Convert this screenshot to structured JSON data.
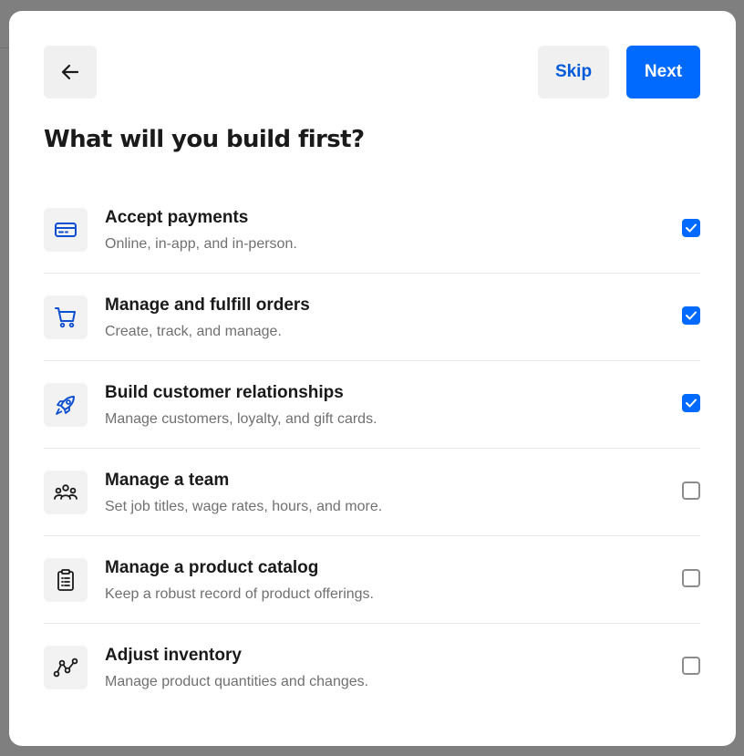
{
  "header": {
    "skip_label": "Skip",
    "next_label": "Next"
  },
  "title": "What will you build first?",
  "options": [
    {
      "icon": "credit-card-icon",
      "title": "Accept payments",
      "subtitle": "Online, in-app, and in-person.",
      "checked": true
    },
    {
      "icon": "shopping-cart-icon",
      "title": "Manage and fulfill orders",
      "subtitle": "Create, track, and manage.",
      "checked": true
    },
    {
      "icon": "rocket-icon",
      "title": "Build customer relationships",
      "subtitle": "Manage customers, loyalty, and gift cards.",
      "checked": true
    },
    {
      "icon": "team-icon",
      "title": "Manage a team",
      "subtitle": "Set job titles, wage rates, hours, and more.",
      "checked": false
    },
    {
      "icon": "clipboard-list-icon",
      "title": "Manage a product catalog",
      "subtitle": "Keep a robust record of product offerings.",
      "checked": false
    },
    {
      "icon": "line-graph-icon",
      "title": "Adjust inventory",
      "subtitle": "Manage product quantities and changes.",
      "checked": false
    }
  ],
  "colors": {
    "accent": "#006aff",
    "skip_text": "#005ad9",
    "icon_blue": "#0d4fd1"
  }
}
